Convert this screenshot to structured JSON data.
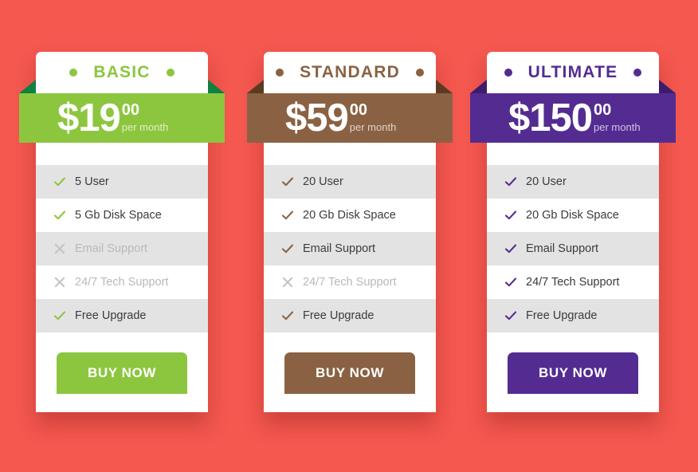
{
  "page": {
    "background_color": "#f4584f",
    "card_color": "#ffffff",
    "row_alt_color": "#e3e3e3",
    "label_color": "#3b3b3b",
    "disabled_color": "#b9b9b9"
  },
  "plans": [
    {
      "name": "BASIC",
      "accent": "#8cc63f",
      "fold": "#0f8140",
      "currency": "$",
      "amount": "19",
      "cents": "00",
      "period": "per month",
      "features": [
        {
          "label": "5 User",
          "enabled": true,
          "icon": "check-icon"
        },
        {
          "label": "5 Gb Disk Space",
          "enabled": true,
          "icon": "check-icon"
        },
        {
          "label": "Email Support",
          "enabled": false,
          "icon": "cross-icon"
        },
        {
          "label": "24/7 Tech Support",
          "enabled": false,
          "icon": "cross-icon"
        },
        {
          "label": "Free Upgrade",
          "enabled": true,
          "icon": "check-icon"
        }
      ],
      "cta": "BUY NOW"
    },
    {
      "name": "STANDARD",
      "accent": "#8a6243",
      "fold": "#5c3a22",
      "currency": "$",
      "amount": "59",
      "cents": "00",
      "period": "per month",
      "features": [
        {
          "label": "20 User",
          "enabled": true,
          "icon": "check-icon"
        },
        {
          "label": "20 Gb Disk Space",
          "enabled": true,
          "icon": "check-icon"
        },
        {
          "label": "Email Support",
          "enabled": true,
          "icon": "check-icon"
        },
        {
          "label": "24/7 Tech Support",
          "enabled": false,
          "icon": "cross-icon"
        },
        {
          "label": "Free Upgrade",
          "enabled": true,
          "icon": "check-icon"
        }
      ],
      "cta": "BUY NOW"
    },
    {
      "name": "ULTIMATE",
      "accent": "#542c91",
      "fold": "#3b1d6b",
      "currency": "$",
      "amount": "150",
      "cents": "00",
      "period": "per month",
      "features": [
        {
          "label": "20 User",
          "enabled": true,
          "icon": "check-icon"
        },
        {
          "label": "20 Gb Disk Space",
          "enabled": true,
          "icon": "check-icon"
        },
        {
          "label": "Email Support",
          "enabled": true,
          "icon": "check-icon"
        },
        {
          "label": "24/7 Tech Support",
          "enabled": true,
          "icon": "check-icon"
        },
        {
          "label": "Free Upgrade",
          "enabled": true,
          "icon": "check-icon"
        }
      ],
      "cta": "BUY NOW"
    }
  ]
}
